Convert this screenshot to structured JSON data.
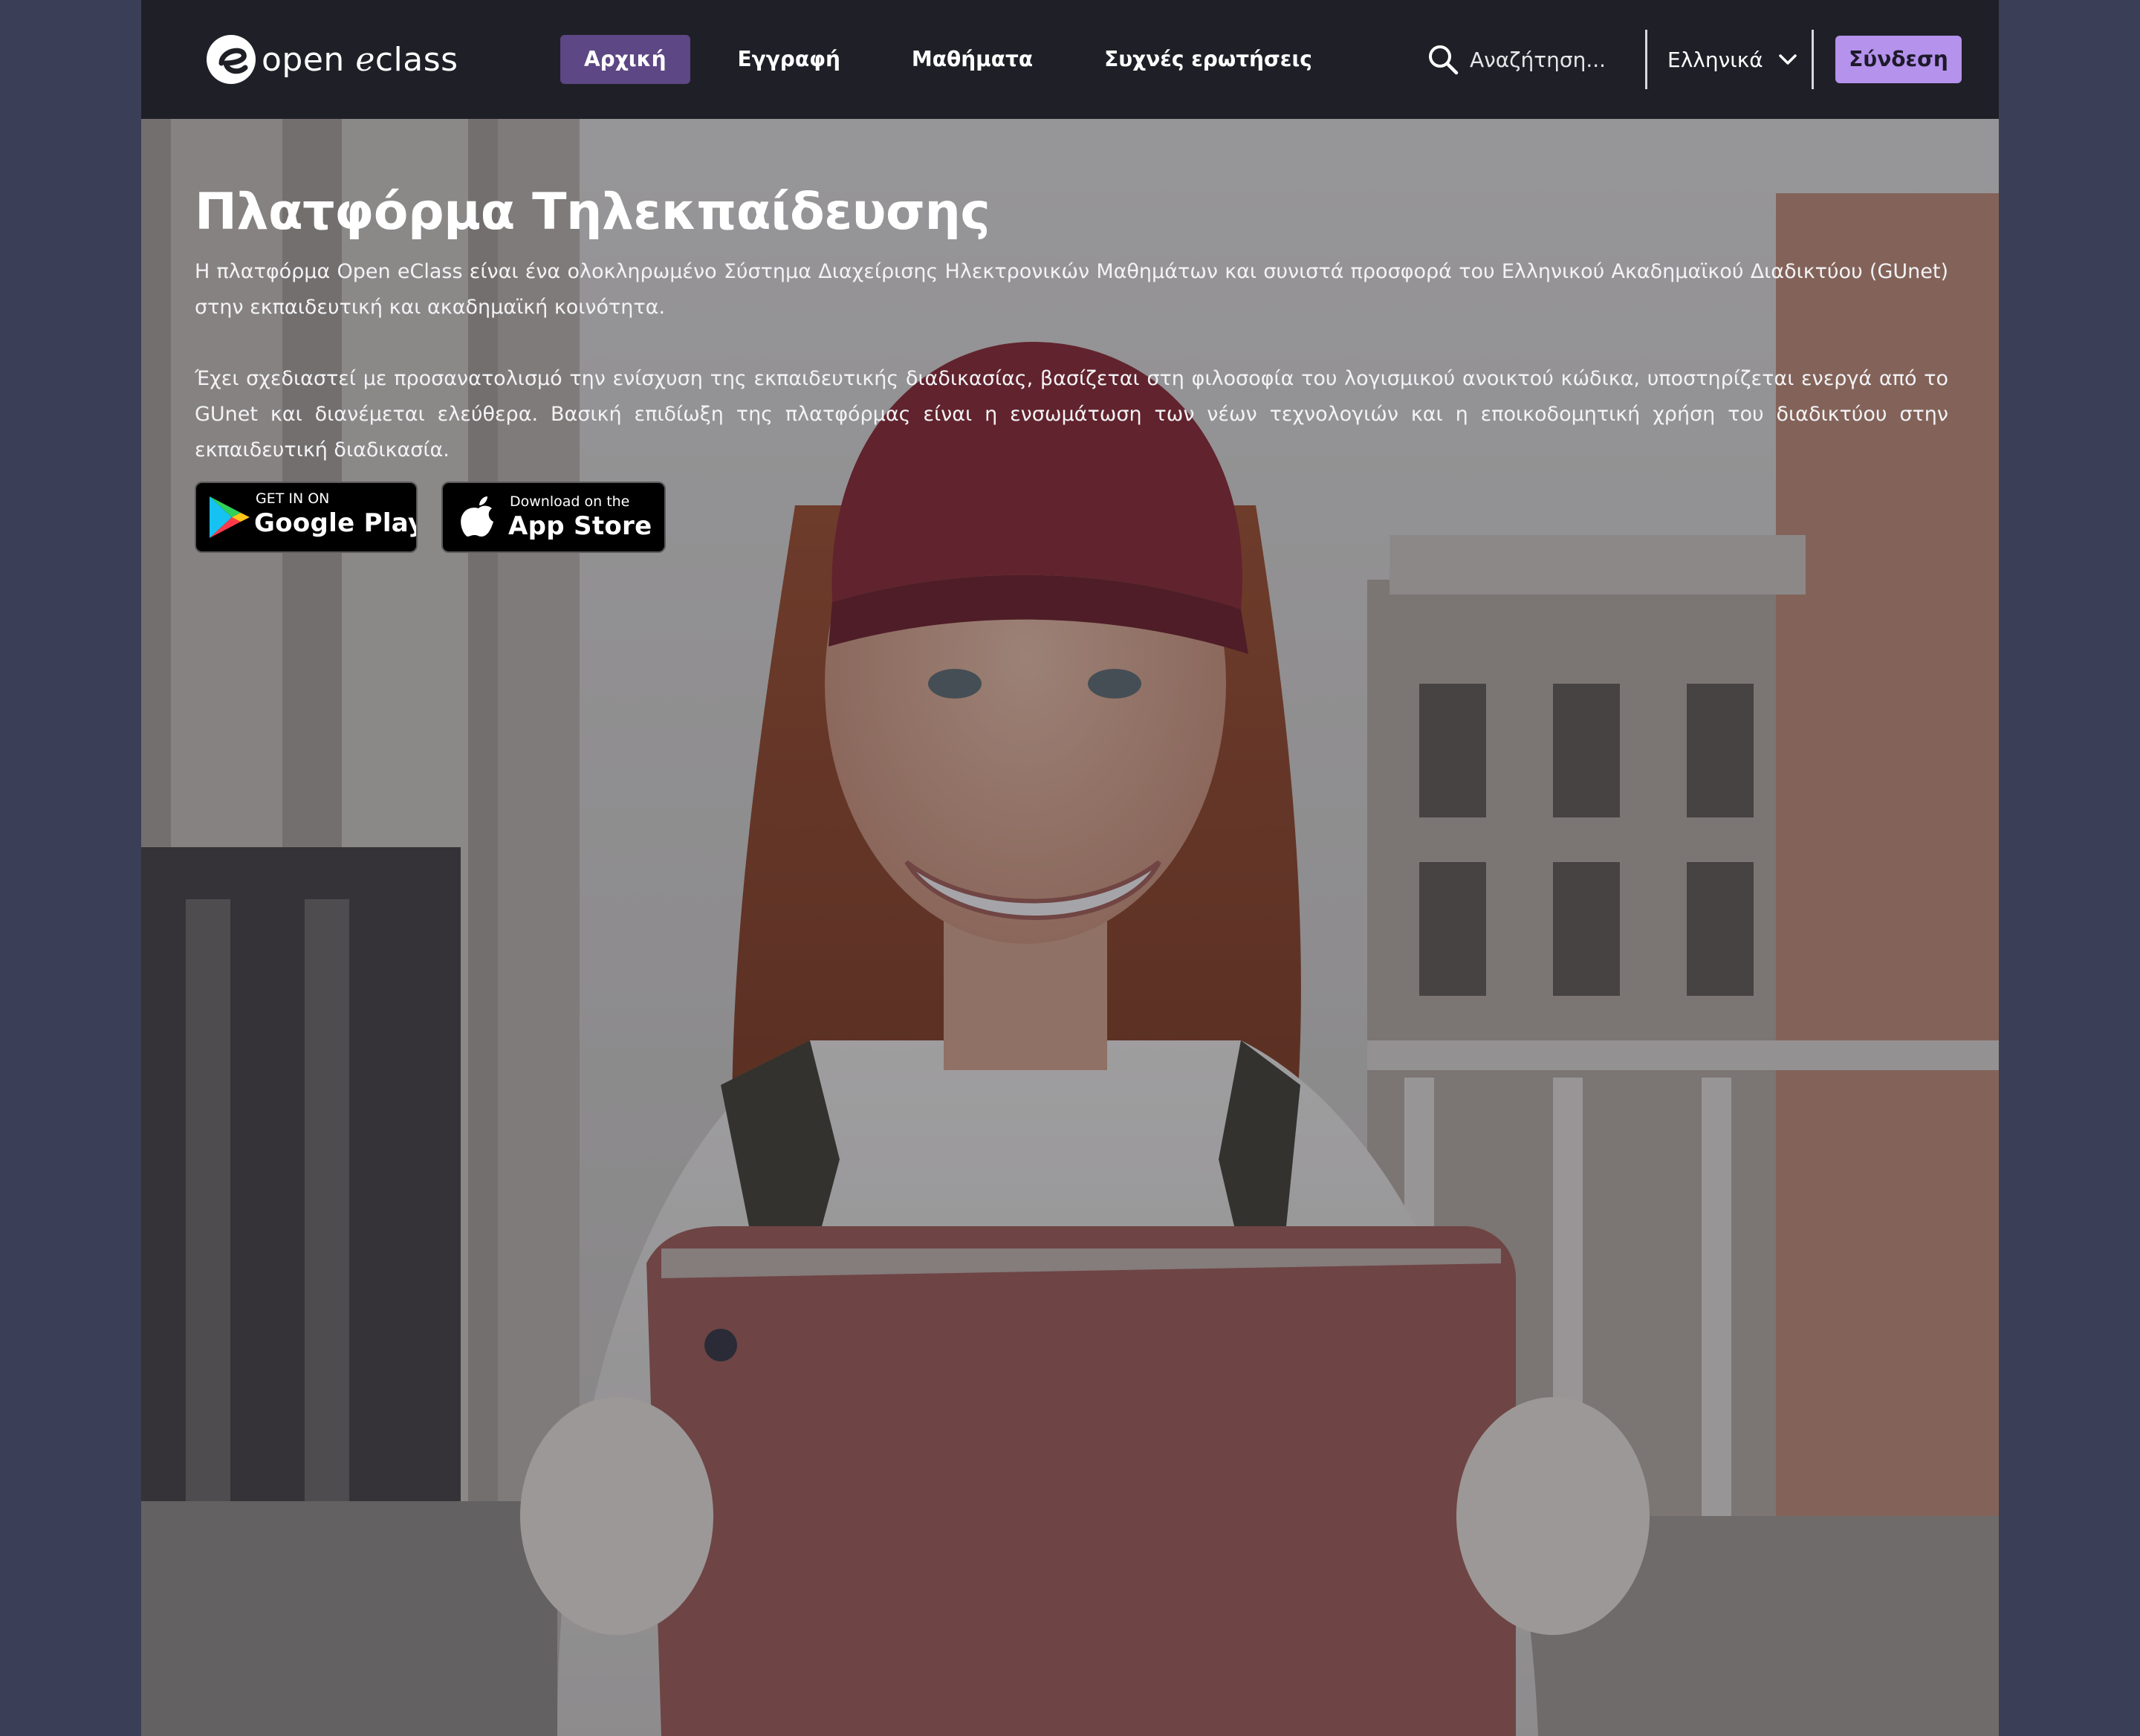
{
  "header": {
    "logo": {
      "text_open": "open",
      "text_e": "e",
      "text_class": "class"
    },
    "nav": {
      "items": [
        {
          "label": "Αρχική",
          "active": true
        },
        {
          "label": "Εγγραφή",
          "active": false
        },
        {
          "label": "Μαθήματα",
          "active": false
        },
        {
          "label": "Συχνές ερωτήσεις",
          "active": false
        }
      ]
    },
    "search": {
      "placeholder": "Αναζήτηση...",
      "icon": "search-icon"
    },
    "language": {
      "selected": "Ελληνικά",
      "icon": "chevron-down-icon"
    },
    "login_label": "Σύνδεση"
  },
  "hero": {
    "title": "Πλατφόρμα Τηλεκπαίδευσης",
    "paragraph_1": "Η πλατφόρμα Open eClass είναι ένα ολοκληρωμένο Σύστημα Διαχείρισης Ηλεκτρονικών Μαθημάτων και συνιστά προσφορά του Ελληνικού Ακαδημαϊκού Διαδικτύου (GUnet) στην εκπαιδευτική και ακαδημαϊκή κοινότητα.",
    "paragraph_2": "Έχει σχεδιαστεί με προσανατολισμό την ενίσχυση της εκπαιδευτικής διαδικασίας, βασίζεται στη φιλοσοφία του λογισμικού ανοικτού κώδικα, υποστηρίζεται ενεργά από το GUnet και διανέμεται ελεύθερα. Βασική επιδίωξη της πλατφόρμας είναι η ενσωμάτωση των νέων τεχνολογιών και η εποικοδομητική χρήση του διαδικτύου στην εκπαιδευτική διαδικασία.",
    "google_play": {
      "small": "GET IN ON",
      "big": "Google Play",
      "icon": "google-play-icon"
    },
    "app_store": {
      "small": "Download on the",
      "big": "App Store",
      "icon": "apple-icon"
    }
  },
  "colors": {
    "page_bg": "#3a3e56",
    "header_bg": "#1f2027",
    "nav_active_bg": "#5d4784",
    "login_bg": "#b592ec",
    "text": "#ffffff"
  }
}
